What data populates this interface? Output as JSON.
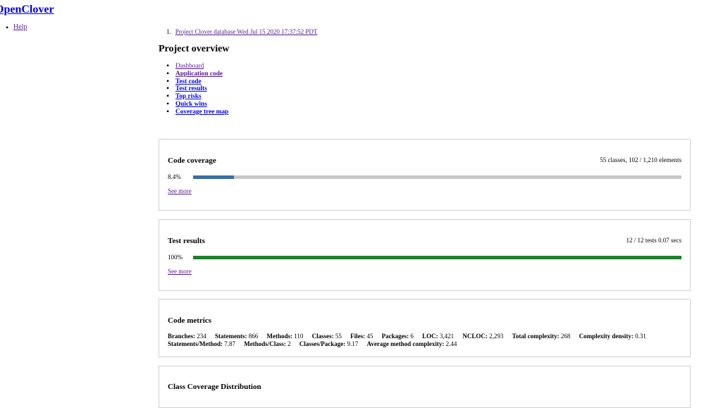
{
  "brand": "OpenClover",
  "help": {
    "label": " Help"
  },
  "breadcrumb": {
    "num": "1.",
    "label": "Project Clover database Wed Jul 15 2020 17:37:52 PDT"
  },
  "page_title": "Project overview",
  "nav": [
    {
      "label": "Dashboard"
    },
    {
      "label": "Application code"
    },
    {
      "label": "Test code"
    },
    {
      "label": "Test results"
    },
    {
      "label": "Top risks"
    },
    {
      "label": "Quick wins"
    },
    {
      "label": "Coverage tree map"
    }
  ],
  "coverage": {
    "title": "Code coverage",
    "summary": "55 classes, 102 / 1,210 elements",
    "percent": "8.4%",
    "fill_fraction": 0.084,
    "fill_color": "#3a6ea5",
    "see_more": "See more"
  },
  "tests": {
    "title": "Test results",
    "summary": "12 / 12 tests 0.07 secs",
    "percent": "100%",
    "fill_fraction": 1.0,
    "fill_color": "#1f7f2e",
    "see_more": "See more"
  },
  "metrics": {
    "title": "Code metrics",
    "items": [
      {
        "label": "Branches:",
        "value": "234"
      },
      {
        "label": "Statements:",
        "value": "866"
      },
      {
        "label": "Methods:",
        "value": "110"
      },
      {
        "label": "Classes:",
        "value": "55"
      },
      {
        "label": "Files:",
        "value": "45"
      },
      {
        "label": "Packages:",
        "value": "6"
      },
      {
        "label": "LOC:",
        "value": "3,421"
      },
      {
        "label": "NCLOC:",
        "value": "2,293"
      },
      {
        "label": "Total complexity:",
        "value": "268"
      },
      {
        "label": "Complexity density:",
        "value": "0.31"
      },
      {
        "label": "Statements/Method:",
        "value": "7.87"
      },
      {
        "label": "Methods/Class:",
        "value": "2"
      },
      {
        "label": "Classes/Package:",
        "value": "9.17"
      },
      {
        "label": "Average method complexity:",
        "value": "2.44"
      }
    ]
  },
  "distribution": {
    "title": "Class Coverage Distribution"
  }
}
